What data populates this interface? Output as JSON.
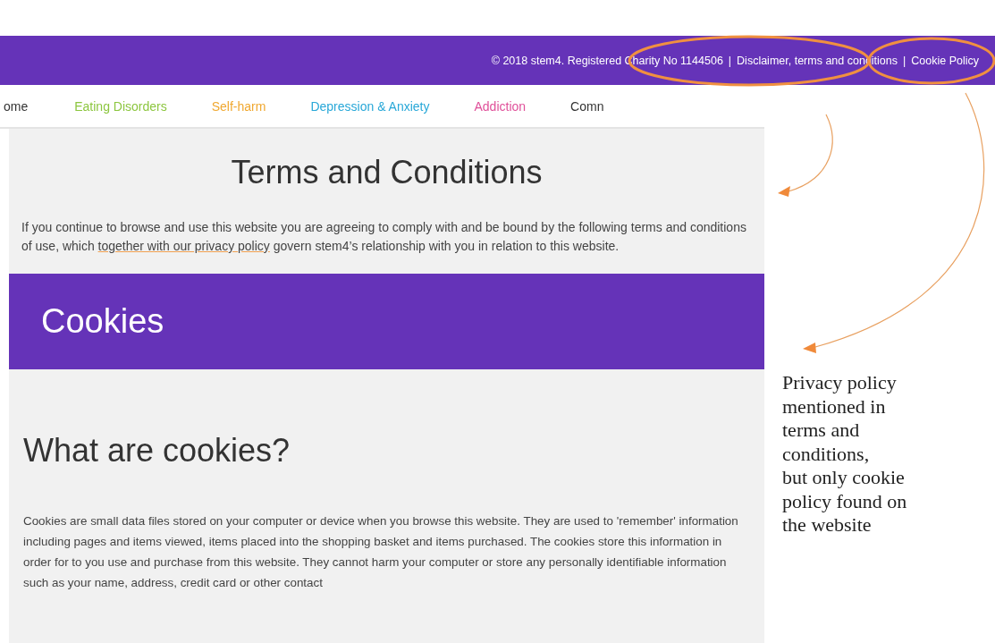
{
  "footer_bar": {
    "copyright": "© 2018 stem4. Registered Charity No 1144506",
    "links": [
      "Disclaimer, terms and conditions",
      "Cookie Policy"
    ],
    "separator": "|"
  },
  "nav": [
    {
      "label": "ome",
      "color": "#333333"
    },
    {
      "label": "Eating Disorders",
      "color": "#8cc63f"
    },
    {
      "label": "Self-harm",
      "color": "#f0a830"
    },
    {
      "label": "Depression & Anxiety",
      "color": "#29a8d8"
    },
    {
      "label": "Addiction",
      "color": "#e0509a"
    },
    {
      "label": "Comn",
      "color": "#333333"
    }
  ],
  "terms": {
    "heading": "Terms and Conditions",
    "text_before": "If you continue to browse and use this website you are agreeing to comply with and be bound by the following terms and conditions of use, which ",
    "link": "together with our privacy policy",
    "text_after": " govern stem4’s relationship with you in relation to this website."
  },
  "cookies_banner": {
    "title": "Cookies"
  },
  "what_are_cookies": {
    "heading": "What are cookies?",
    "text": "Cookies are small data files stored on your computer or device when you browse this website. They are used to 'remember' information including pages and items viewed, items placed into the shopping basket and items purchased. The cookies store this information in order for to you use and purchase from this website. They cannot harm your computer or store any personally identifiable information such as your name, address, credit card or other contact"
  },
  "annotation": {
    "note_lines": [
      "Privacy policy",
      "mentioned in",
      "terms and",
      "conditions,",
      "but only cookie",
      "policy found on",
      "the website"
    ]
  }
}
